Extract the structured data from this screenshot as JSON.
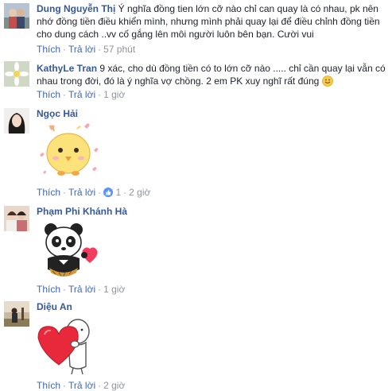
{
  "comments": [
    {
      "author": "Dung Nguyễn Thị",
      "text": "Ý nghĩa đồng tien lớn cỡ nào chỉ can quay là có nhau, pk nên nhớ đồng tiền điều khiển mình, nhưng mình phải quay lại để điều chỉnh đồng tiền cho dung cách ..vv cố gắng lên môi người luôn bên bạn. Cười vui",
      "like_label": "Thích",
      "reply_label": "Trả lời",
      "time": "57 phút"
    },
    {
      "author": "KathyLe Tran",
      "text": "9 xác, cho dù đồng tiền có to lớn cỡ nào ..... chỉ cần quay lại vẫn có nhau trong đời, đó là ý nghĩa vợ chồng. 2 em PK xuy nghĩ rất đúng",
      "like_label": "Thích",
      "reply_label": "Trả lời",
      "time": "1 giờ"
    },
    {
      "author": "Ngọc Hải",
      "like_label": "Thích",
      "reply_label": "Trả lời",
      "like_count": "1",
      "time": "2 giờ"
    },
    {
      "author": "Phạm Phi Khánh Hà",
      "like_label": "Thích",
      "reply_label": "Trả lời",
      "time": "1 giờ"
    },
    {
      "author": "Diệu An",
      "like_label": "Thích",
      "reply_label": "Trả lời",
      "time": "2 giờ"
    }
  ],
  "separator": "·",
  "colors": {
    "author": "#365899",
    "link": "#4267b2",
    "meta": "#90949c",
    "like_badge": "#5890ff"
  }
}
